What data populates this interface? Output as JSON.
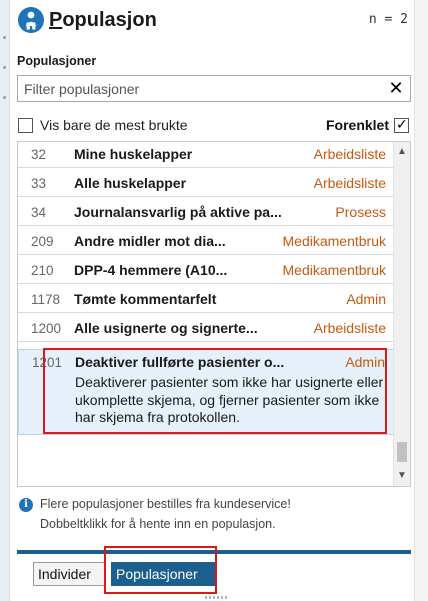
{
  "header": {
    "title_first": "P",
    "title_rest": "opulasjon",
    "count": "n = 2"
  },
  "populations_label": "Populasjoner",
  "filter": {
    "placeholder": "Filter populasjoner",
    "clear_icon": "✕"
  },
  "options": {
    "most_used_label": "Vis bare de mest brukte",
    "most_used_checked": false,
    "simplified_label": "Forenklet",
    "simplified_checked": true
  },
  "list": {
    "rows": [
      {
        "num": "32",
        "name": "Mine huskelapper",
        "type": "Arbeidsliste"
      },
      {
        "num": "33",
        "name": "Alle huskelapper",
        "type": "Arbeidsliste"
      },
      {
        "num": "34",
        "name": "Journalansvarlig på aktive pa...",
        "type": "Prosess"
      },
      {
        "num": "209",
        "name": "Andre midler mot dia...",
        "type": "Medikamentbruk"
      },
      {
        "num": "210",
        "name": "DPP-4 hemmere (A10...",
        "type": "Medikamentbruk"
      },
      {
        "num": "1178",
        "name": "Tømte kommentarfelt",
        "type": "Admin"
      },
      {
        "num": "1200",
        "name": "Alle usignerte og signerte...",
        "type": "Arbeidsliste"
      }
    ],
    "selected": {
      "num": "1201",
      "name": "Deaktiver fullførte pasienter o...",
      "type": "Admin",
      "description": "Deaktiverer pasienter som ikke har usignerte eller ukomplette skjema, og fjerner pasienter som ikke har skjema fra protokollen."
    }
  },
  "info": {
    "line1": "Flere populasjoner bestilles fra kundeservice!",
    "line2": "Dobbeltklikk for å hente inn en populasjon."
  },
  "tabs": {
    "individer": "Individer",
    "populasjoner": "Populasjoner"
  },
  "colors": {
    "accent": "#1b5f8e",
    "type_text": "#c55a11",
    "highlight": "#d91a1a"
  }
}
